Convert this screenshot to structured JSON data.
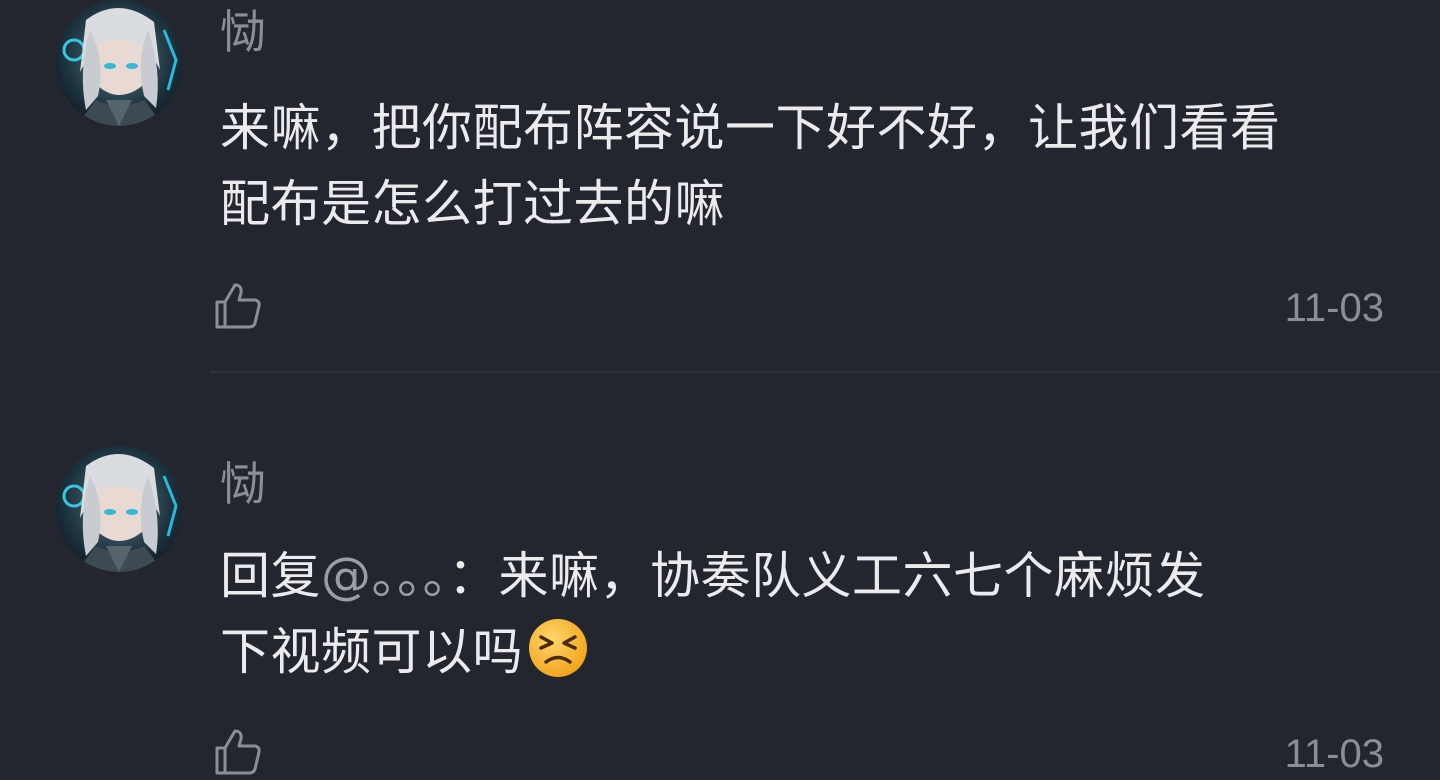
{
  "comments": [
    {
      "username": "恸",
      "text_lines": [
        "来嘛，把你配布阵容说一下好不好，让我们看看",
        "配布是怎么打过去的嘛"
      ],
      "date": "11-03",
      "avatar_icon": "anime-avatar-icon"
    },
    {
      "username": "恸",
      "reply_prefix": "回复",
      "mention": "@。。。",
      "reply_text": "：来嘛，协奏队义工六七个麻烦发",
      "text_line2": "下视频可以吗",
      "emoji": "tired-face-emoji",
      "date": "11-03",
      "avatar_icon": "anime-avatar-icon"
    }
  ],
  "icons": {
    "like": "thumbs-up-icon"
  },
  "colors": {
    "background": "#23252f",
    "text": "#ebebed",
    "meta": "#8c8e96",
    "divider": "#30323c"
  }
}
